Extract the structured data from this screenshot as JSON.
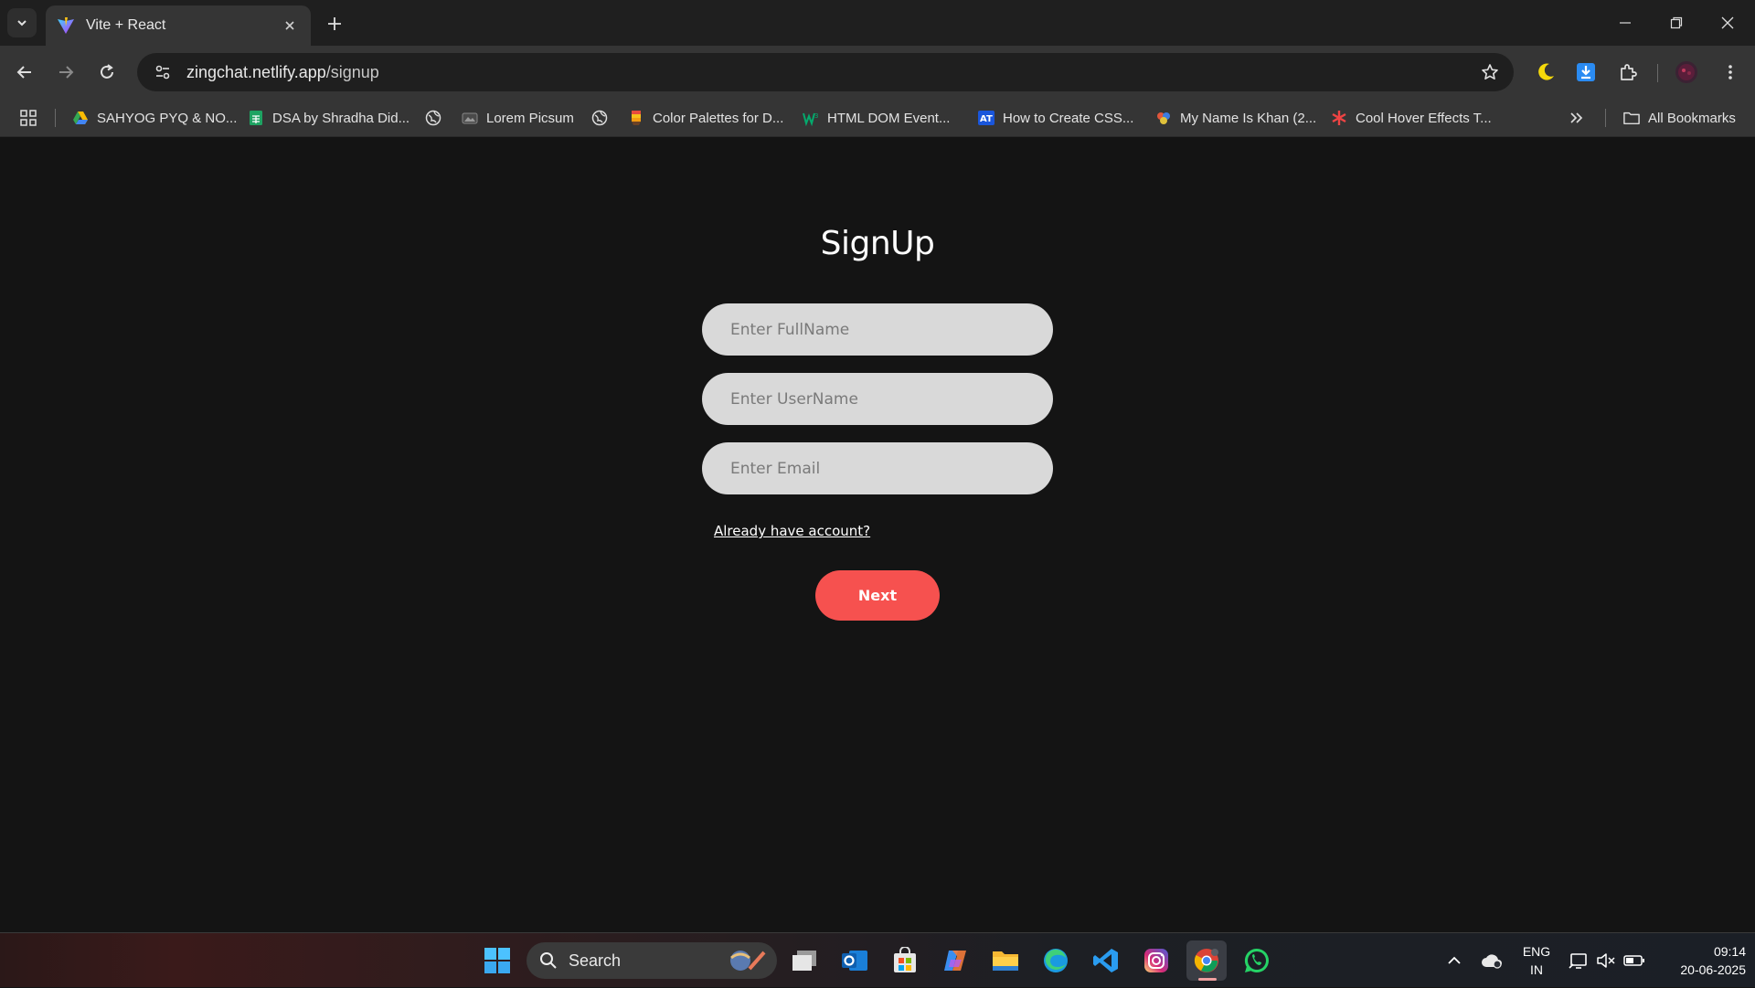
{
  "browser": {
    "tab_title": "Vite + React",
    "url_host": "zingchat.netlify.app",
    "url_path": "/signup"
  },
  "bookmarks": [
    {
      "label": "SAHYOG PYQ & NO...",
      "icon": "google-drive-icon"
    },
    {
      "label": "DSA by Shradha Did...",
      "icon": "sheets-icon"
    },
    {
      "label": "",
      "icon": "globe-icon"
    },
    {
      "label": "Lorem Picsum",
      "icon": "picsum-icon"
    },
    {
      "label": "",
      "icon": "globe-icon"
    },
    {
      "label": "Color Palettes for D...",
      "icon": "palette-icon"
    },
    {
      "label": "HTML DOM Event...",
      "icon": "w3schools-icon"
    },
    {
      "label": "How to Create CSS...",
      "icon": "at-icon"
    },
    {
      "label": "My Name Is Khan (2...",
      "icon": "movie-icon"
    },
    {
      "label": "Cool Hover Effects T...",
      "icon": "asterisk-icon"
    }
  ],
  "all_bookmarks_label": "All Bookmarks",
  "signup": {
    "title": "SignUp",
    "fullname_placeholder": "Enter FullName",
    "username_placeholder": "Enter UserName",
    "email_placeholder": "Enter Email",
    "login_link": "Already have account?",
    "next_label": "Next"
  },
  "taskbar": {
    "search_label": "Search",
    "lang_line1": "ENG",
    "lang_line2": "IN",
    "time": "09:14",
    "date": "20-06-2025"
  },
  "colors": {
    "accent": "#f6514f",
    "field_bg": "#d9d9d9",
    "page_bg": "#141414"
  }
}
